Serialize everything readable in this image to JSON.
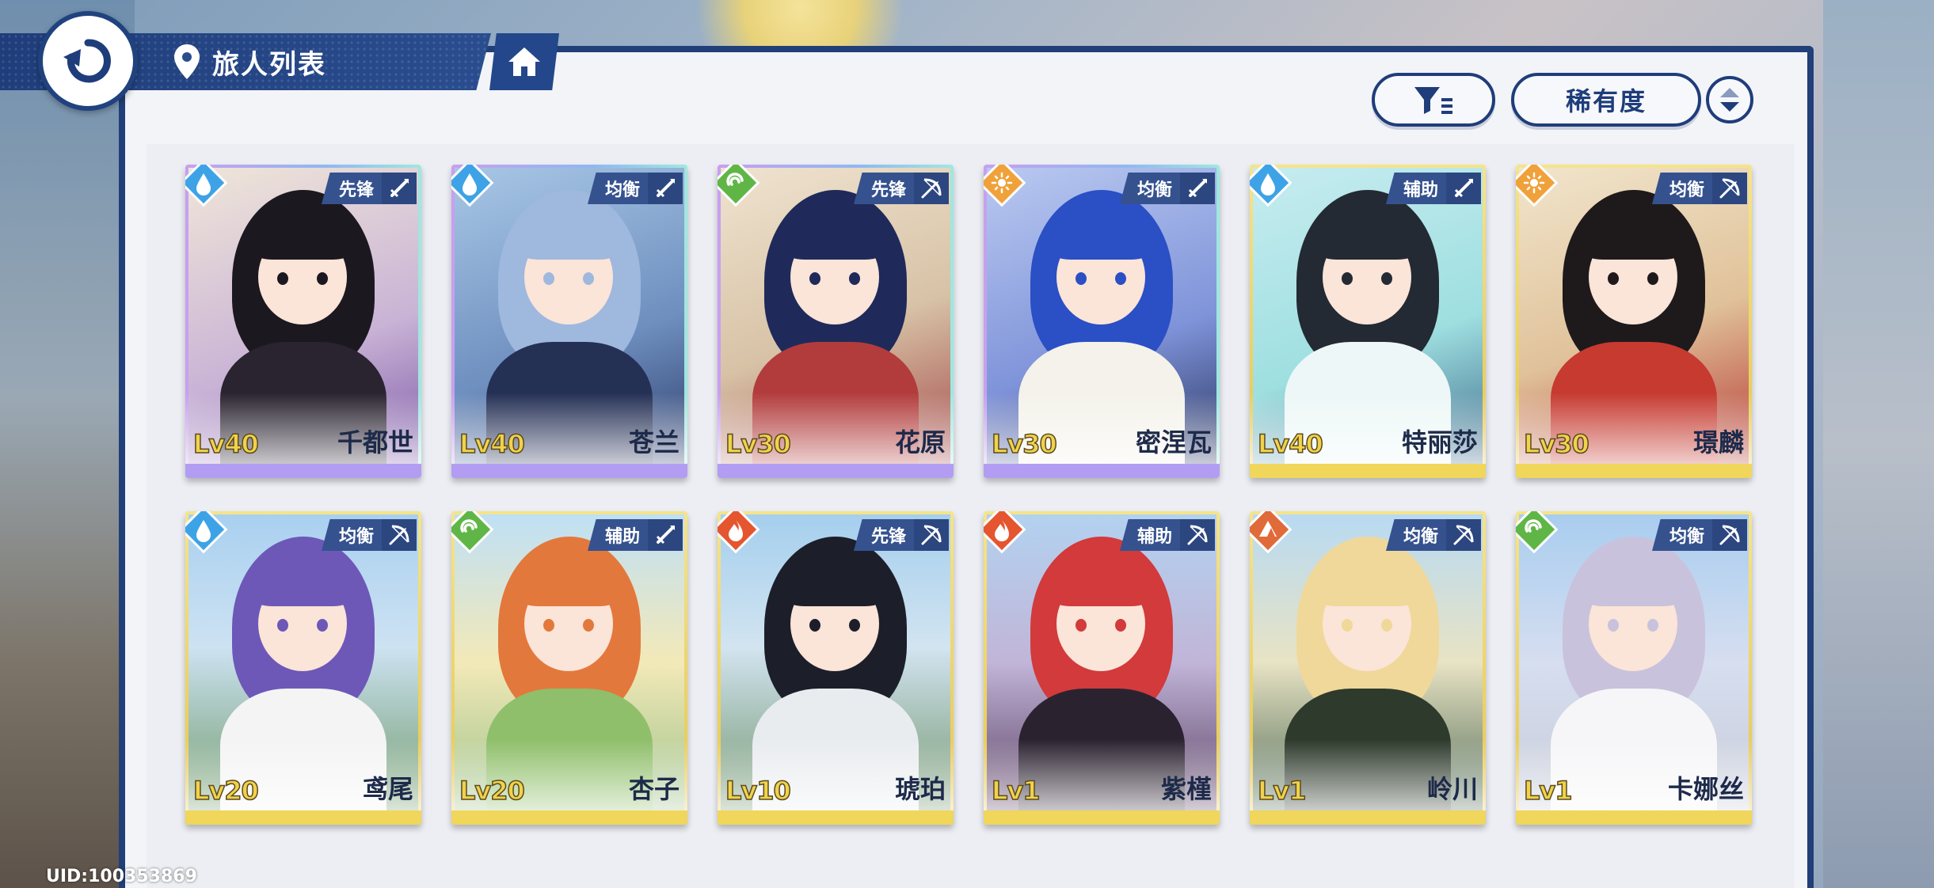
{
  "header": {
    "title": "旅人列表"
  },
  "toolbar": {
    "sort_label": "稀有度"
  },
  "uid": "UID:100353869",
  "colors": {
    "accent": "#1f3d7a",
    "ssr_bar": "#f0d65a",
    "sr_bar": "#b39df2"
  },
  "cards": [
    {
      "level": "Lv40",
      "name": "千都世",
      "role": "先锋",
      "element": "water",
      "weapon": "sword",
      "rarity": "sr"
    },
    {
      "level": "Lv40",
      "name": "苍兰",
      "role": "均衡",
      "element": "water",
      "weapon": "sword",
      "rarity": "sr"
    },
    {
      "level": "Lv30",
      "name": "花原",
      "role": "先锋",
      "element": "wind",
      "weapon": "bow",
      "rarity": "sr"
    },
    {
      "level": "Lv30",
      "name": "密涅瓦",
      "role": "均衡",
      "element": "light",
      "weapon": "sword",
      "rarity": "sr"
    },
    {
      "level": "Lv40",
      "name": "特丽莎",
      "role": "辅助",
      "element": "water",
      "weapon": "sword",
      "rarity": "ssr"
    },
    {
      "level": "Lv30",
      "name": "璟麟",
      "role": "均衡",
      "element": "light",
      "weapon": "bow",
      "rarity": "ssr"
    },
    {
      "level": "Lv20",
      "name": "鸢尾",
      "role": "均衡",
      "element": "water",
      "weapon": "bow",
      "rarity": "ssr"
    },
    {
      "level": "Lv20",
      "name": "杏子",
      "role": "辅助",
      "element": "wind",
      "weapon": "sword",
      "rarity": "ssr"
    },
    {
      "level": "Lv10",
      "name": "琥珀",
      "role": "先锋",
      "element": "fire",
      "weapon": "bow",
      "rarity": "ssr"
    },
    {
      "level": "Lv1",
      "name": "紫槿",
      "role": "辅助",
      "element": "fire",
      "weapon": "bow",
      "rarity": "ssr"
    },
    {
      "level": "Lv1",
      "name": "岭川",
      "role": "均衡",
      "element": "earth",
      "weapon": "bow",
      "rarity": "ssr"
    },
    {
      "level": "Lv1",
      "name": "卡娜丝",
      "role": "均衡",
      "element": "wind",
      "weapon": "bow",
      "rarity": "ssr"
    }
  ]
}
